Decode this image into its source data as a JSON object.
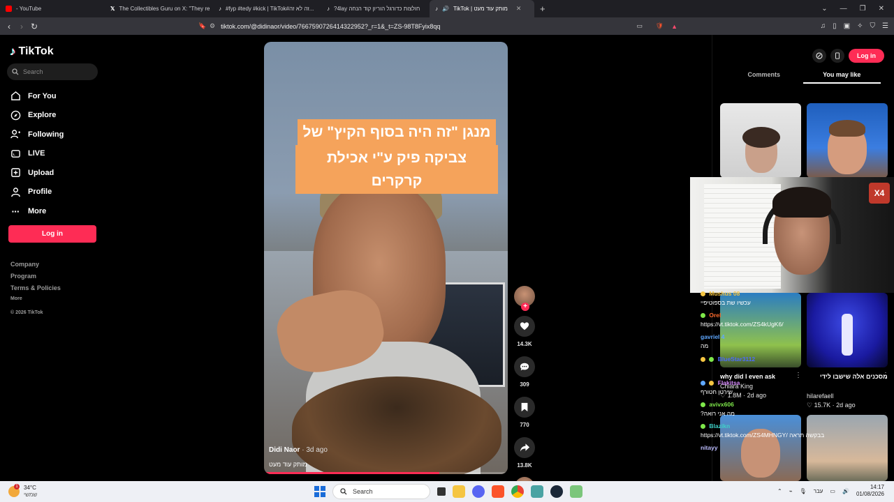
{
  "browser": {
    "tabs": [
      {
        "label": "- YouTube",
        "color": "#ff0000",
        "active": false
      },
      {
        "label": "The Collectibles Guru on X: \"They re",
        "color": "#000000",
        "active": false
      },
      {
        "label": "#fyp #tedy #kick | TikTok#זה לא זה...",
        "color": "#000000",
        "active": false
      },
      {
        "label": "?4lay חולצות כדורגל הוריון קוד הנחה",
        "color": "#000000",
        "active": false
      },
      {
        "label": "TikTok | מותק עוד מעט",
        "color": "#000000",
        "active": true
      }
    ],
    "url": "tiktok.com/@didinaor/video/7667590726414322952?_r=1&_t=ZS-98T8Fyix8qq"
  },
  "sidebar": {
    "logo": "TikTok",
    "search_placeholder": "Search",
    "nav": [
      {
        "label": "For You",
        "icon": "home-icon"
      },
      {
        "label": "Explore",
        "icon": "compass-icon"
      },
      {
        "label": "Following",
        "icon": "following-icon"
      },
      {
        "label": "LIVE",
        "icon": "live-icon"
      },
      {
        "label": "Upload",
        "icon": "upload-icon"
      },
      {
        "label": "Profile",
        "icon": "profile-icon"
      },
      {
        "label": "More",
        "icon": "more-icon"
      }
    ],
    "login_label": "Log in",
    "footer": {
      "company": "Company",
      "program": "Program",
      "terms": "Terms & Policies",
      "more": "More",
      "copyright": "© 2026 TikTok"
    }
  },
  "video": {
    "caption_line1": "מנגן \"זה היה בסוף הקיץ\" של",
    "caption_line2": "צביקה פיק ע\"י אכילת קרקרים",
    "author": "Didi Naor",
    "posted": "· 3d ago",
    "description": "מותק עוד מעט",
    "progress": 0.72
  },
  "actions": {
    "likes": "14.3K",
    "comments": "309",
    "saves": "770",
    "shares": "13.8K"
  },
  "right_panel": {
    "login_label": "Log in",
    "tab_comments": "Comments",
    "tab_you_may_like": "You may like",
    "video1": {
      "title": "why did I even ask",
      "user": "Chiara King",
      "likes": "1.8M",
      "date": "· 2d ago"
    },
    "video2": {
      "title": "מסכנים אלה שישבו לידי",
      "user": "hilarefaell",
      "likes": "15.7K",
      "date": "· 2d ago"
    }
  },
  "webcam": {
    "badge": "X4"
  },
  "chat": [
    {
      "name": "Mushus 08",
      "color": "#f5c542",
      "text": "עכשיו שת בספוטיפיי"
    },
    {
      "name": "Orel",
      "color": "#ff6b2d",
      "text": "https://vt.tiktok.com/ZS4kUgK6/"
    },
    {
      "name": "gavriel 4",
      "color": "#5fa8ff",
      "text": "מה"
    },
    {
      "name": "BlueStar3112",
      "color": "#4c6bff",
      "text": ""
    },
    {
      "name": "Flakitsa",
      "color": "#d98cff",
      "text": "שירטן חטורף"
    },
    {
      "name": "avivx606",
      "color": "#7ee84a",
      "text": "מה אני רואה?"
    },
    {
      "name": "Blazikn",
      "color": "#3ed2c8",
      "text": "https://vt.tiktok.com/ZS4MHNGY/ בבקשה תראה"
    },
    {
      "name": "nitayy",
      "color": "#bdbdff",
      "text": ""
    }
  ],
  "taskbar": {
    "temperature": "34°C",
    "weather_label": "שמשי",
    "weather_badge": "1",
    "search_placeholder": "Search",
    "language": "עבר",
    "time": "14:17",
    "date": "01/08/2026"
  }
}
